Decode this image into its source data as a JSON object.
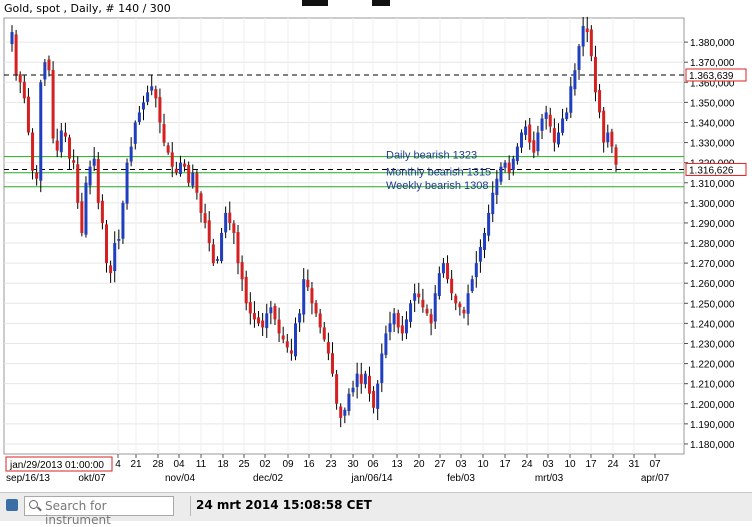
{
  "header": {
    "title": "Gold, spot , Daily, # 140 / 300"
  },
  "price_axis": {
    "ticks": [
      "1.380,000",
      "1.370,000",
      "1.360,000",
      "1.350,000",
      "1.340,000",
      "1.330,000",
      "1.320,000",
      "1.310,000",
      "1.300,000",
      "1.290,000",
      "1.280,000",
      "1.270,000",
      "1.260,000",
      "1.250,000",
      "1.240,000",
      "1.230,000",
      "1.220,000",
      "1.210,000",
      "1.200,000",
      "1.190,000",
      "1.180,000"
    ],
    "labels": [
      {
        "text": "1.363,639",
        "value": 1363.639,
        "color": "#e02020"
      },
      {
        "text": "1.316,626",
        "value": 1316.626,
        "color": "#e02020"
      }
    ]
  },
  "time_axis": {
    "day_labels": [
      "4",
      "21",
      "28",
      "04",
      "11",
      "18",
      "25",
      "02",
      "09",
      "16",
      "23",
      "30",
      "06",
      "13",
      "20",
      "27",
      "03",
      "10",
      "17",
      "24",
      "03",
      "10",
      "17",
      "24",
      "31",
      "07"
    ],
    "month_labels": [
      "sep/16/13",
      "okt/07",
      "nov/04",
      "dec/02",
      "jan/06/14",
      "feb/03",
      "mrt/03",
      "apr/07"
    ],
    "cursor_label": "jan/29/2013 01:00:00"
  },
  "annotations": {
    "daily": "Daily bearish 1323",
    "monthly": "Monthly bearish 1315",
    "weekly": "Weekly bearish 1308"
  },
  "statusbar": {
    "search_placeholder": "Search for instrument",
    "datetime": "24 mrt 2014 15:08:58 CET"
  },
  "colors": {
    "up": "#1f3fbf",
    "down": "#d42020",
    "level_line": "#22aa22",
    "dashed": "#000000",
    "annotation": "#1c3c8c"
  },
  "chart_data": {
    "type": "candlestick",
    "title": "Gold, spot , Daily, # 140 / 300",
    "xlabel": "",
    "ylabel": "",
    "ylim": [
      1175,
      1392
    ],
    "grid": true,
    "horizontal_lines": [
      {
        "value": 1363.639,
        "style": "dashed",
        "color": "#000000"
      },
      {
        "value": 1316.626,
        "style": "dashed",
        "color": "#000000"
      },
      {
        "value": 1323,
        "style": "solid",
        "color": "#22aa22",
        "label": "Daily bearish 1323"
      },
      {
        "value": 1315,
        "style": "solid",
        "color": "#22aa22",
        "label": "Monthly bearish 1315"
      },
      {
        "value": 1308,
        "style": "solid",
        "color": "#22aa22",
        "label": "Weekly bearish 1308"
      }
    ],
    "closes": [
      1385,
      1364,
      1360,
      1352,
      1335,
      1316,
      1312,
      1360,
      1370,
      1366,
      1332,
      1326,
      1336,
      1333,
      1322,
      1320,
      1300,
      1285,
      1310,
      1318,
      1322,
      1300,
      1290,
      1270,
      1265,
      1280,
      1282,
      1300,
      1320,
      1328,
      1340,
      1345,
      1350,
      1355,
      1358,
      1352,
      1340,
      1330,
      1325,
      1318,
      1315,
      1320,
      1318,
      1310,
      1315,
      1305,
      1295,
      1290,
      1280,
      1270,
      1272,
      1285,
      1295,
      1290,
      1285,
      1270,
      1262,
      1250,
      1245,
      1242,
      1240,
      1238,
      1245,
      1248,
      1242,
      1235,
      1232,
      1228,
      1225,
      1240,
      1245,
      1262,
      1258,
      1250,
      1245,
      1238,
      1232,
      1225,
      1215,
      1200,
      1193,
      1197,
      1205,
      1208,
      1215,
      1210,
      1215,
      1205,
      1198,
      1210,
      1225,
      1235,
      1240,
      1245,
      1238,
      1235,
      1242,
      1250,
      1255,
      1253,
      1248,
      1245,
      1240,
      1255,
      1265,
      1270,
      1262,
      1255,
      1250,
      1248,
      1245,
      1255,
      1262,
      1270,
      1278,
      1285,
      1295,
      1305,
      1312,
      1318,
      1320,
      1315,
      1322,
      1328,
      1335,
      1338,
      1330,
      1325,
      1335,
      1342,
      1345,
      1338,
      1330,
      1335,
      1342,
      1345,
      1358,
      1366,
      1378,
      1388,
      1385,
      1373,
      1355,
      1345,
      1330,
      1335,
      1328,
      1319
    ]
  }
}
